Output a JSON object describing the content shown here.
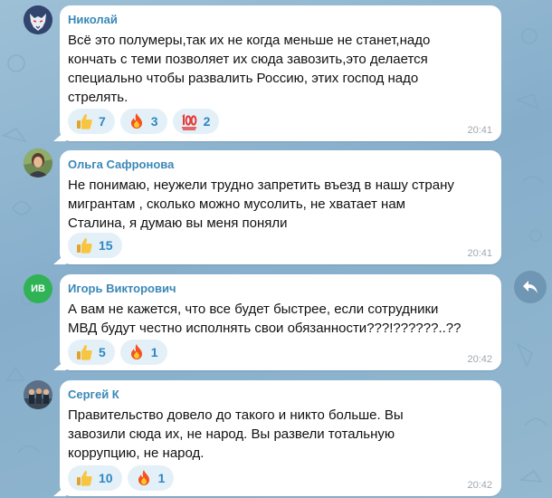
{
  "colors": {
    "background": "#8fb5d0",
    "bubble": "#ffffff",
    "sender_name": "#3a88b8",
    "reaction_chip": "#e4f0f8",
    "reaction_count": "#2e86c1",
    "timestamp": "#a0a8b0",
    "avatar_initials_bg": "#2fb356"
  },
  "messages": [
    {
      "sender": "Николай",
      "avatar": "wolf-avatar-icon",
      "text_lines": [
        "Всё это полумеры,так их не когда меньше не станет,надо",
        "кончать с теми позволяет их сюда завозить,это делается",
        "специально чтобы развалить Россию, этих господ надо",
        "стрелять."
      ],
      "reactions": [
        {
          "emoji": "thumbs-up-icon",
          "count": "7"
        },
        {
          "emoji": "fire-icon",
          "count": "3"
        },
        {
          "emoji": "hundred-points-icon",
          "count": "2"
        }
      ],
      "time": "20:41"
    },
    {
      "sender": "Ольга Сафронова",
      "avatar": "woman-photo-avatar",
      "text_lines": [
        "Не понимаю, неужели трудно запретить въезд в нашу страну",
        "мигрантам , сколько можно мусолить, не хватает нам",
        "Сталина, я думаю вы меня поняли"
      ],
      "reactions": [
        {
          "emoji": "thumbs-up-icon",
          "count": "15"
        }
      ],
      "time": "20:41"
    },
    {
      "sender": "Игорь Викторович",
      "avatar_initials": "ИВ",
      "text_lines": [
        "А вам не кажется, что все будет быстрее, если сотрудники",
        "МВД будут честно исполнять свои обязанности???!??????..??"
      ],
      "reactions": [
        {
          "emoji": "thumbs-up-icon",
          "count": "5"
        },
        {
          "emoji": "fire-icon",
          "count": "1"
        }
      ],
      "time": "20:42"
    },
    {
      "sender": "Сергей К",
      "avatar": "group-photo-avatar",
      "text_lines": [
        "Правительство довело до такого и никто больше. Вы",
        "завозили сюда их, не народ. Вы развели тотальную",
        "коррупцию, не народ."
      ],
      "reactions": [
        {
          "emoji": "thumbs-up-icon",
          "count": "10"
        },
        {
          "emoji": "fire-icon",
          "count": "1"
        }
      ],
      "time": "20:42"
    }
  ],
  "reply_button": {
    "icon": "reply-arrow-icon"
  }
}
